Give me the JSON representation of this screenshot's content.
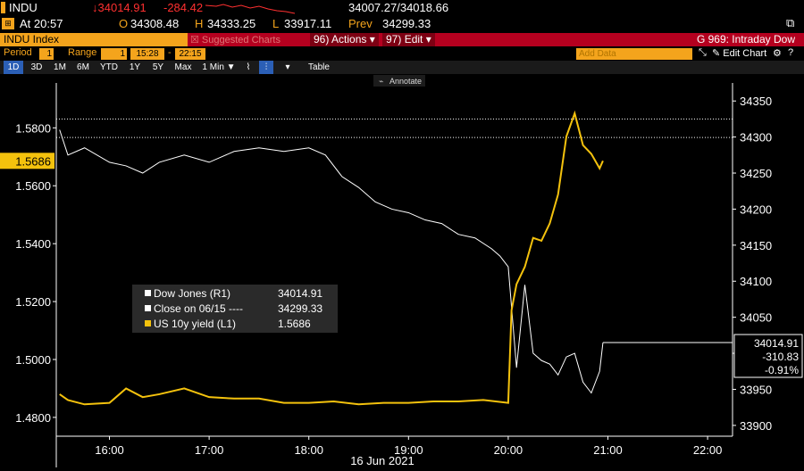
{
  "quote": {
    "ticker": "INDU",
    "last": "↓34014.91",
    "change": "-284.42",
    "bid_ask": "34007.27/34018.66",
    "time": "At 20:57",
    "open_label": "O",
    "open": "34308.48",
    "high_label": "H",
    "high": "34333.25",
    "low_label": "L",
    "low": "33917.11",
    "prev_label": "Prev",
    "prev": "34299.33"
  },
  "command": {
    "security": "INDU Index",
    "suggested": "Suggested Charts",
    "actions_num": "96)",
    "actions": "Actions",
    "edit_num": "97)",
    "edit": "Edit",
    "title": "G 969: Intraday Dow"
  },
  "params": {
    "period_label": "Period",
    "period_value": "1",
    "range_label": "Range",
    "range_value": "1",
    "range_start": "15:28",
    "range_sep": "-",
    "range_end": "22:15",
    "add_data": "Add Data",
    "edit_chart": "Edit Chart"
  },
  "tools": {
    "periods": [
      "1D",
      "3D",
      "1M",
      "6M",
      "YTD",
      "1Y",
      "5Y",
      "Max"
    ],
    "interval": "1 Min ▼",
    "table": "Table",
    "annotate": "Annotate"
  },
  "colors": {
    "dow": "#ffffff",
    "yield": "#f4c20d",
    "axis": "#ffffff",
    "amber": "#f4a41c",
    "red": "#b5001f"
  },
  "chart_data": {
    "type": "line",
    "xlabel": "16 Jun 2021",
    "x_ticks": [
      "16:00",
      "17:00",
      "18:00",
      "19:00",
      "20:00",
      "21:00",
      "22:00"
    ],
    "x_range": [
      "15:28",
      "22:15"
    ],
    "y_left": {
      "ticks": [
        "1.4800",
        "1.5000",
        "1.5200",
        "1.5400",
        "1.5600",
        "1.5800"
      ],
      "range": [
        1.4735,
        1.5955
      ],
      "current": "1.5686"
    },
    "y_right": {
      "ticks": [
        "33900",
        "33950",
        "34000",
        "34050",
        "34100",
        "34150",
        "34200",
        "34250",
        "34300",
        "34350"
      ],
      "range": [
        33885,
        34375
      ],
      "current": "34014.91",
      "change": "-310.83",
      "change_pct": "-0.91%"
    },
    "legend": [
      {
        "label": "Dow Jones (R1)",
        "value": "34014.91"
      },
      {
        "label": "Close on 06/15 ----",
        "value": "34299.33"
      },
      {
        "label": "US 10y yield (L1)",
        "value": "1.5686"
      }
    ],
    "reference_lines": [
      {
        "label": "Close on 06/15",
        "value": 34299.33
      }
    ],
    "series": [
      {
        "name": "Dow Jones (R1)",
        "axis": "right",
        "x": [
          "15:30",
          "15:35",
          "15:45",
          "16:00",
          "16:10",
          "16:20",
          "16:30",
          "16:45",
          "17:00",
          "17:15",
          "17:30",
          "17:45",
          "18:00",
          "18:10",
          "18:20",
          "18:30",
          "18:40",
          "18:50",
          "19:00",
          "19:10",
          "19:20",
          "19:30",
          "19:40",
          "19:50",
          "19:55",
          "20:00",
          "20:05",
          "20:10",
          "20:15",
          "20:20",
          "20:25",
          "20:30",
          "20:35",
          "20:40",
          "20:45",
          "20:50",
          "20:55",
          "20:57"
        ],
        "values": [
          34310,
          34275,
          34285,
          34265,
          34260,
          34250,
          34265,
          34275,
          34265,
          34280,
          34285,
          34280,
          34285,
          34275,
          34245,
          34230,
          34210,
          34200,
          34195,
          34185,
          34180,
          34165,
          34160,
          34145,
          34135,
          34120,
          33980,
          34095,
          34000,
          33990,
          33985,
          33970,
          33995,
          34000,
          33960,
          33945,
          33975,
          34014.91
        ]
      },
      {
        "name": "US 10y yield (L1)",
        "axis": "left",
        "x": [
          "15:30",
          "15:35",
          "15:45",
          "16:00",
          "16:10",
          "16:20",
          "16:30",
          "16:45",
          "17:00",
          "17:15",
          "17:30",
          "17:45",
          "18:00",
          "18:15",
          "18:30",
          "18:45",
          "19:00",
          "19:15",
          "19:30",
          "19:45",
          "20:00",
          "20:02",
          "20:05",
          "20:10",
          "20:15",
          "20:20",
          "20:25",
          "20:30",
          "20:35",
          "20:40",
          "20:45",
          "20:50",
          "20:55",
          "20:57"
        ],
        "values": [
          1.488,
          1.486,
          1.4845,
          1.485,
          1.49,
          1.487,
          1.488,
          1.49,
          1.487,
          1.4865,
          1.4865,
          1.485,
          1.485,
          1.4855,
          1.4845,
          1.485,
          1.485,
          1.4855,
          1.4855,
          1.486,
          1.485,
          1.517,
          1.526,
          1.532,
          1.542,
          1.541,
          1.547,
          1.557,
          1.577,
          1.585,
          1.574,
          1.571,
          1.566,
          1.5686
        ]
      }
    ]
  }
}
